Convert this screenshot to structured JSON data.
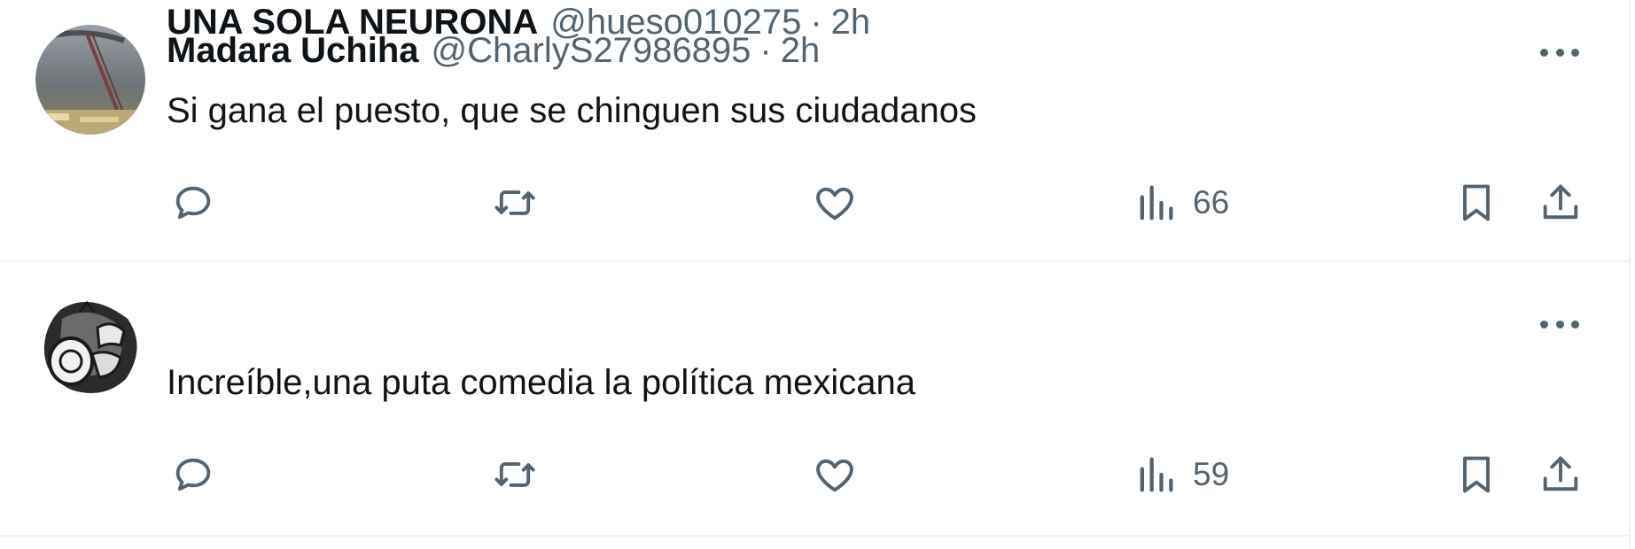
{
  "colors": {
    "text": "#0f1419",
    "secondary": "#536471",
    "divider": "#eff3f4"
  },
  "tweets": [
    {
      "name": "Madara Uchiha",
      "handle": "@CharlyS27986895",
      "separator": "·",
      "time": "2h",
      "text": "Si gana el puesto, que se chinguen sus ciudadanos",
      "views": "66"
    },
    {
      "name": "UNA SOLA NEURONA",
      "handle": "@hueso010275",
      "separator": "·",
      "time": "2h",
      "text": "Increíble,una puta comedia la política mexicana",
      "views": "59"
    }
  ],
  "icons": [
    "reply-icon",
    "retweet-icon",
    "like-icon",
    "views-icon",
    "bookmark-icon",
    "share-icon",
    "more-icon"
  ]
}
